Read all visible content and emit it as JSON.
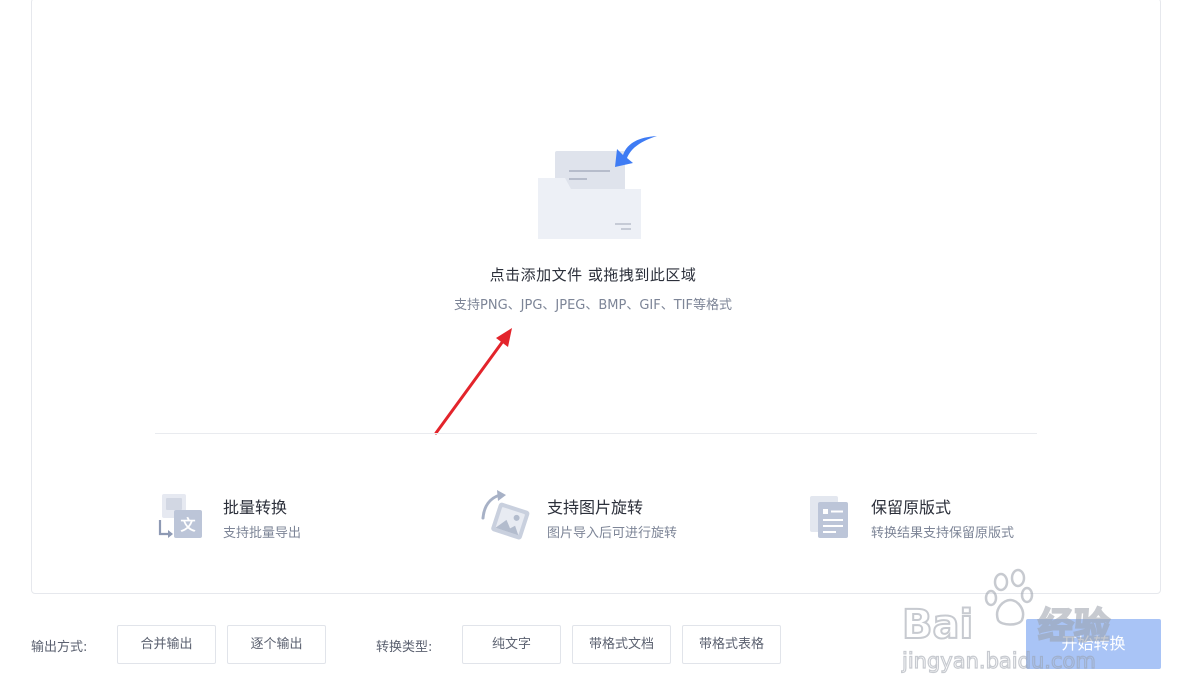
{
  "upload": {
    "title": "点击添加文件 或拖拽到此区域",
    "subtitle": "支持PNG、JPG、JPEG、BMP、GIF、TIF等格式"
  },
  "features": [
    {
      "title": "批量转换",
      "desc": "支持批量导出",
      "icon": "batch-convert-icon"
    },
    {
      "title": "支持图片旋转",
      "desc": "图片导入后可进行旋转",
      "icon": "image-rotate-icon"
    },
    {
      "title": "保留原版式",
      "desc": "转换结果支持保留原版式",
      "icon": "keep-layout-icon"
    }
  ],
  "output_mode": {
    "label": "输出方式:",
    "options": [
      "合并输出",
      "逐个输出"
    ]
  },
  "convert_type": {
    "label": "转换类型:",
    "options": [
      "纯文字",
      "带格式文档",
      "带格式表格"
    ]
  },
  "start_button": "开始转换",
  "watermark": {
    "brand": "Baidu经验",
    "url": "jingyan.baidu.com"
  },
  "colors": {
    "accent_blue": "#3f7cf4",
    "start_button_bg": "#a9c4f6",
    "annotation_arrow": "#e3242b"
  }
}
